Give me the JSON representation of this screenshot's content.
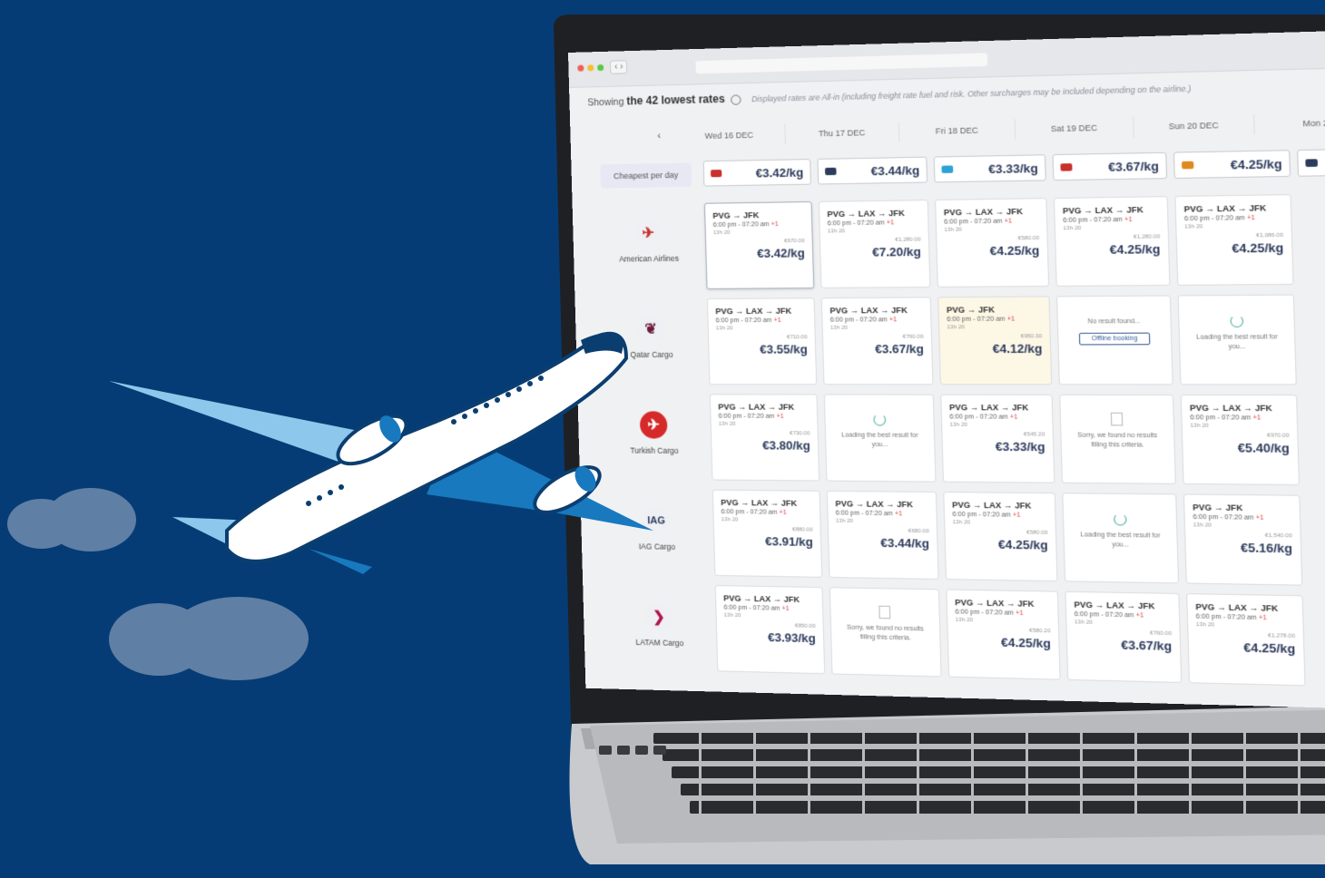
{
  "colors": {
    "background": "#053c75",
    "accent": "#2d3b5c",
    "plane_light": "#8ec7ec",
    "plane_dark": "#0b3e70"
  },
  "results": {
    "showing_prefix": "Showing",
    "showing_count": "the 42 lowest rates",
    "disclaimer": "Displayed rates are All-in (including freight rate fuel and risk. Other surcharges may be included depending on the airline.)"
  },
  "dates": [
    "Wed 16 DEC",
    "Thu 17 DEC",
    "Fri 18 DEC",
    "Sat 19 DEC",
    "Sun 20 DEC",
    "Mon 2"
  ],
  "cheapest": {
    "label": "Cheapest per day",
    "prices": [
      "€3.42/kg",
      "€3.44/kg",
      "€3.33/kg",
      "€3.67/kg",
      "€4.25/kg",
      ""
    ]
  },
  "airlines": [
    "American Airlines",
    "Qatar Cargo",
    "Turkish Cargo",
    "IAG Cargo",
    "LATAM Cargo"
  ],
  "iag_logo_text": "IAG",
  "cards": {
    "aa_wed": {
      "route": "PVG → JFK",
      "time": "6:00 pm - 07:20 am",
      "plus": "+1",
      "dur": "13h 20",
      "total": "€670.00",
      "rate": "€3.42/kg"
    },
    "aa_thu": {
      "route": "PVG → LAX → JFK",
      "time": "6:00 pm - 07:20 am",
      "plus": "+1",
      "dur": "13h 20",
      "total": "€1,280.00",
      "rate": "€7.20/kg"
    },
    "aa_fri": {
      "route": "PVG → LAX → JFK",
      "time": "6:00 pm - 07:20 am",
      "plus": "+1",
      "dur": "13h 20",
      "total": "€580.00",
      "rate": "€4.25/kg"
    },
    "aa_sat": {
      "route": "PVG → LAX → JFK",
      "time": "6:00 pm - 07:20 am",
      "plus": "+1",
      "dur": "13h 20",
      "total": "€1,280.00",
      "rate": "€4.25/kg"
    },
    "aa_sun": {
      "route": "PVG → LAX → JFK",
      "time": "6:00 pm - 07:20 am",
      "plus": "+1",
      "dur": "13h 20",
      "total": "€1,086.00",
      "rate": "€4.25/kg"
    },
    "qr_wed": {
      "route": "PVG → LAX → JFK",
      "time": "6:00 pm - 07:20 am",
      "plus": "+1",
      "dur": "13h 20",
      "total": "€710.00",
      "rate": "€3.55/kg"
    },
    "qr_thu": {
      "route": "PVG → LAX → JFK",
      "time": "6:00 pm - 07:20 am",
      "plus": "+1",
      "dur": "13h 20",
      "total": "€760.00",
      "rate": "€3.67/kg"
    },
    "qr_fri": {
      "route": "PVG → JFK",
      "time": "6:00 pm - 07:20 am",
      "plus": "+1",
      "dur": "13h 20",
      "total": "€950.30",
      "rate": "€4.12/kg"
    },
    "tk_wed": {
      "route": "PVG → LAX → JFK",
      "time": "6:00 pm - 07:20 am",
      "plus": "+1",
      "dur": "13h 20",
      "total": "€730.00",
      "rate": "€3.80/kg"
    },
    "tk_fri": {
      "route": "PVG → LAX → JFK",
      "time": "6:00 pm - 07:20 am",
      "plus": "+1",
      "dur": "13h 20",
      "total": "€545.20",
      "rate": "€3.33/kg"
    },
    "tk_sun": {
      "route": "PVG → LAX → JFK",
      "time": "6:00 pm - 07:20 am",
      "plus": "+1",
      "dur": "13h 20",
      "total": "€970.00",
      "rate": "€5.40/kg"
    },
    "ia_wed": {
      "route": "PVG → LAX → JFK",
      "time": "6:00 pm - 07:20 am",
      "plus": "+1",
      "dur": "13h 20",
      "total": "€880.00",
      "rate": "€3.91/kg"
    },
    "ia_thu": {
      "route": "PVG → LAX → JFK",
      "time": "6:00 pm - 07:20 am",
      "plus": "+1",
      "dur": "13h 20",
      "total": "€680.00",
      "rate": "€3.44/kg"
    },
    "ia_fri": {
      "route": "PVG → LAX → JFK",
      "time": "6:00 pm - 07:20 am",
      "plus": "+1",
      "dur": "13h 20",
      "total": "€580.00",
      "rate": "€4.25/kg"
    },
    "ia_sun": {
      "route": "PVG → JFK",
      "time": "6:00 pm - 07:20 am",
      "plus": "+1",
      "dur": "13h 20",
      "total": "€1,540.00",
      "rate": "€5.16/kg"
    },
    "la_wed": {
      "route": "PVG → LAX → JFK",
      "time": "6:00 pm - 07:20 am",
      "plus": "+1",
      "dur": "13h 20",
      "total": "€850.00",
      "rate": "€3.93/kg"
    },
    "la_fri": {
      "route": "PVG → LAX → JFK",
      "time": "6:00 pm - 07:20 am",
      "plus": "+1",
      "dur": "13h 20",
      "total": "€580.20",
      "rate": "€4.25/kg"
    },
    "la_sat": {
      "route": "PVG → LAX → JFK",
      "time": "6:00 pm - 07:20 am",
      "plus": "+1",
      "dur": "13h 20",
      "total": "€760.00",
      "rate": "€3.67/kg"
    },
    "la_sun": {
      "route": "PVG → LAX → JFK",
      "time": "6:00 pm - 07:20 am",
      "plus": "+1",
      "dur": "13h 20",
      "total": "€1,278.00",
      "rate": "€4.25/kg"
    }
  },
  "messages": {
    "no_result": "No result found...",
    "offline_booking": "Offline booking",
    "loading": "Loading the best result for you...",
    "sorry": "Sorry, we found no results filling this criteria."
  }
}
